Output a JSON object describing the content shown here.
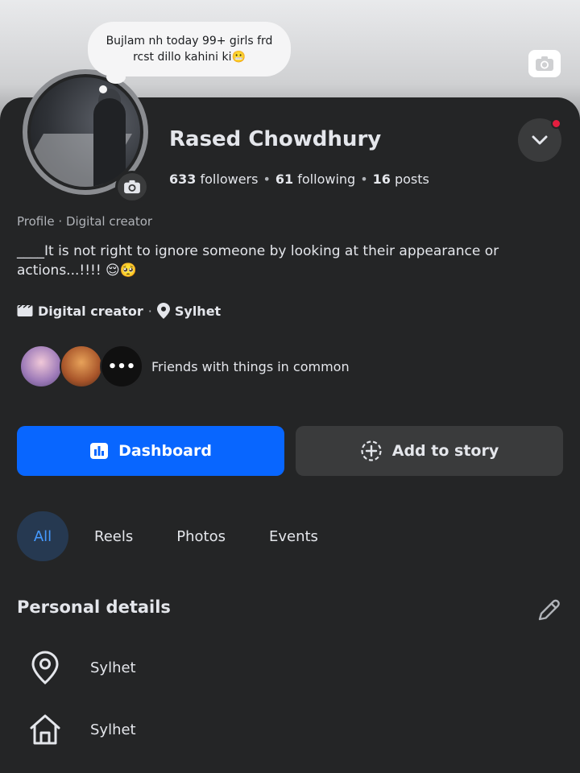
{
  "note": {
    "text": "Bujlam nh today 99+ girls frd rcst dillo kahini ki😬"
  },
  "profile": {
    "name": "Rased Chowdhury",
    "followers_count": "633",
    "followers_label": "followers",
    "following_count": "61",
    "following_label": "following",
    "posts_count": "16",
    "posts_label": "posts",
    "category_line": "Profile · Digital creator",
    "bio": "____It is not right to ignore someone by looking at their appearance or actions...!!!! 😌🥺",
    "meta_category": "Digital creator",
    "meta_location": "Sylhet",
    "friends_label": "Friends with things in common"
  },
  "buttons": {
    "dashboard": "Dashboard",
    "add_story": "Add to story"
  },
  "tabs": [
    {
      "label": "All"
    },
    {
      "label": "Reels"
    },
    {
      "label": "Photos"
    },
    {
      "label": "Events"
    }
  ],
  "personal_details": {
    "title": "Personal details",
    "items": [
      {
        "icon": "location-pin-icon",
        "value": "Sylhet"
      },
      {
        "icon": "home-icon",
        "value": "Sylhet"
      }
    ]
  },
  "colors": {
    "background": "#242526",
    "primary_button": "#0866ff",
    "secondary_button": "#3a3b3c",
    "active_tab_bg": "#263951",
    "active_tab_text": "#4599ff",
    "notification_dot": "#e41e3f"
  }
}
